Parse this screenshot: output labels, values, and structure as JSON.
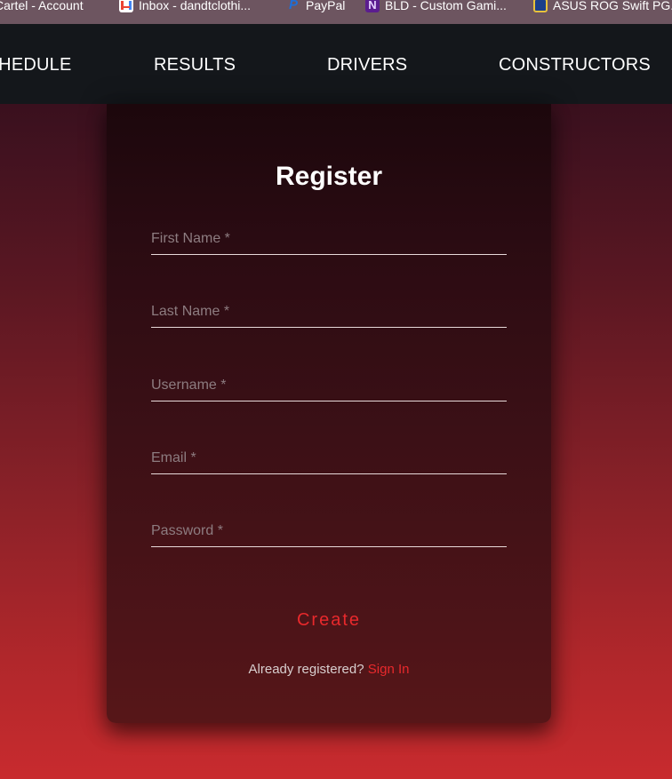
{
  "bookmarks": [
    {
      "label": "Cartel - Account",
      "icon": "cartel-icon"
    },
    {
      "label": "Inbox - dandtclothi...",
      "icon": "gmail-icon"
    },
    {
      "label": "PayPal",
      "icon": "paypal-icon"
    },
    {
      "label": "BLD - Custom Gami...",
      "icon": "bld-icon"
    },
    {
      "label": "ASUS ROG Swift PG...",
      "icon": "asus-icon"
    }
  ],
  "nav": {
    "items": [
      "SCHEDULE",
      "RESULTS",
      "DRIVERS",
      "CONSTRUCTORS"
    ]
  },
  "form": {
    "title": "Register",
    "fields": [
      {
        "placeholder": "First Name *",
        "value": ""
      },
      {
        "placeholder": "Last Name *",
        "value": ""
      },
      {
        "placeholder": "Username *",
        "value": ""
      },
      {
        "placeholder": "Email *",
        "value": ""
      },
      {
        "placeholder": "Password *",
        "value": ""
      }
    ],
    "submit_label": "Create",
    "footer_text": "Already registered? ",
    "footer_link": "Sign In"
  },
  "colors": {
    "accent": "#e8292c",
    "nav_bg": "#14171b",
    "bookmark_bar_bg": "#6d5560",
    "card_top": "#1c070c",
    "card_bottom": "#571618",
    "page_bottom": "#c82b2e"
  }
}
